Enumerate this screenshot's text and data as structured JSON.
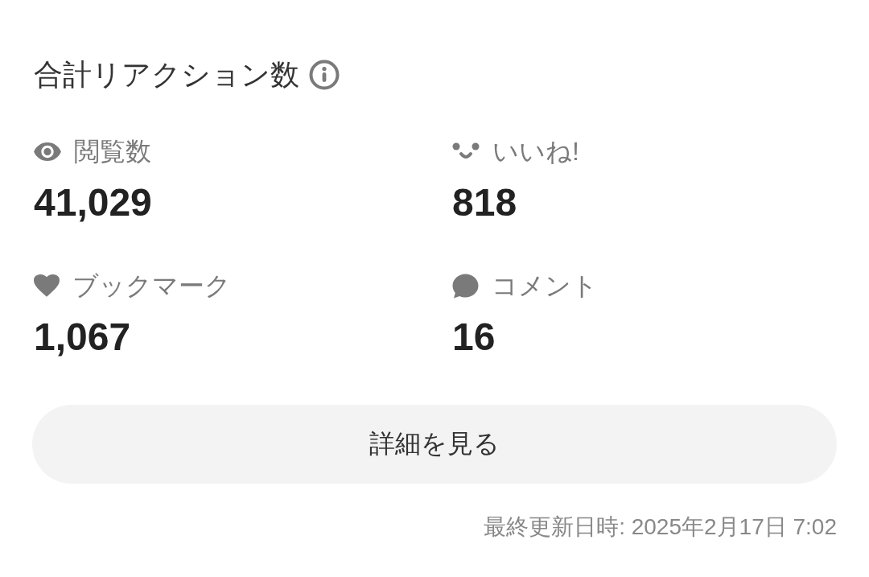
{
  "title": "合計リアクション数",
  "stats": [
    {
      "kind": "views",
      "label": "閲覧数",
      "value": "41,029"
    },
    {
      "kind": "likes",
      "label": "いいね!",
      "value": "818"
    },
    {
      "kind": "bookmarks",
      "label": "ブックマーク",
      "value": "1,067"
    },
    {
      "kind": "comments",
      "label": "コメント",
      "value": "16"
    }
  ],
  "details_button": "詳細を見る",
  "last_updated": "最終更新日時: 2025年2月17日 7:02"
}
